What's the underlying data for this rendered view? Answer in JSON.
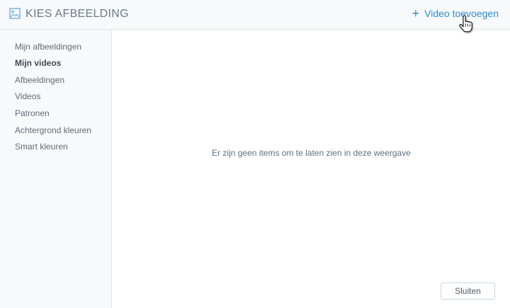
{
  "header": {
    "title": "KIES AFBEELDING",
    "title_icon": "image-icon",
    "add_video_icon": "plus-icon",
    "add_video_label": "Video toevoegen"
  },
  "sidebar": {
    "items": [
      {
        "label": "Mijn afbeeldingen",
        "active": false
      },
      {
        "label": "Mijn videos",
        "active": true
      },
      {
        "label": "Afbeeldingen",
        "active": false
      },
      {
        "label": "Videos",
        "active": false
      },
      {
        "label": "Patronen",
        "active": false
      },
      {
        "label": "Achtergrond kleuren",
        "active": false
      },
      {
        "label": "Smart kleuren",
        "active": false
      }
    ]
  },
  "main": {
    "empty_message": "Er zijn geen items om te laten zien in deze weergave"
  },
  "footer": {
    "close_label": "Sluiten"
  },
  "colors": {
    "accent": "#2a8ad8",
    "sidebar_bg": "#f8f9fa",
    "text_muted": "#5f6b77"
  }
}
